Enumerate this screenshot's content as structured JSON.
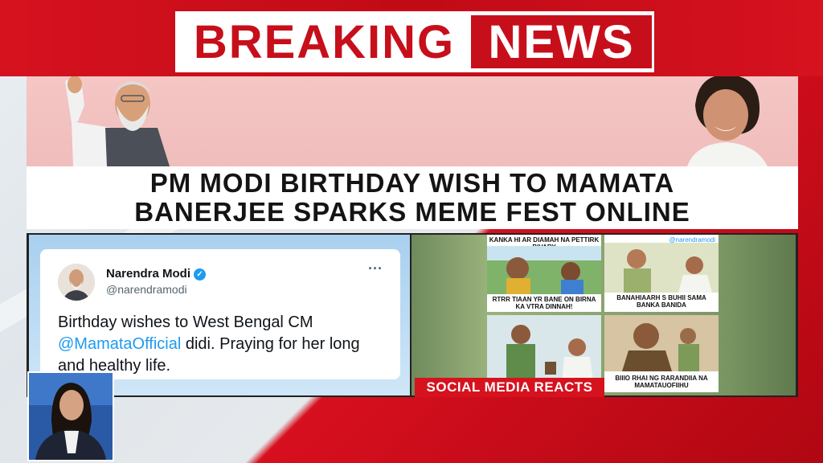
{
  "breaking": {
    "word1": "BREAKING",
    "word2": "NEWS"
  },
  "headline": {
    "line1": "PM MODI BIRTHDAY WISH TO MAMATA",
    "line2": "BANERJEE SPARKS MEME FEST ONLINE"
  },
  "tweet": {
    "name": "Narendra Modi",
    "handle": "@narendramodi",
    "more": "···",
    "text_before": "Birthday wishes to West Bengal CM ",
    "mention": "@MamataOfficial",
    "text_after": " didi. Praying for her long and healthy life."
  },
  "memes": {
    "m1_top": "KANKA HI AR DIAMAH NA PETTIRK BIVARY",
    "m1_bottom": "RTRR TIAAN YR BANE ON BIRNA KA VTRA DINNAH!",
    "m2_top": "@narendramodi",
    "m2_bottom": "BANAHIAARH S BUHII SAMA BANKA BANIDA",
    "m4_bottom": "BIIIO RHAI NG RARANDIIA NA MAMATAUOFIIHU"
  },
  "reacts_label": "SOCIAL MEDIA REACTS",
  "colors": {
    "brand_red": "#c70f1b",
    "twitter_blue": "#1d9bf0"
  }
}
